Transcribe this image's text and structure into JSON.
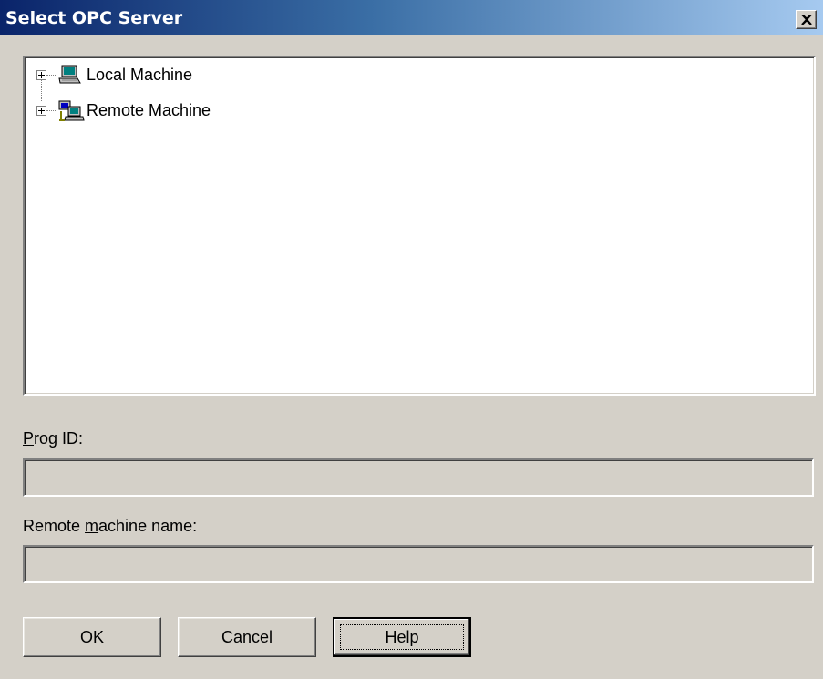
{
  "window": {
    "title": "Select OPC Server",
    "close_icon": "close-icon"
  },
  "tree": {
    "nodes": [
      {
        "label": "Local Machine",
        "icon": "computer-icon",
        "expander": "plus"
      },
      {
        "label": "Remote Machine",
        "icon": "network-computers-icon",
        "expander": "plus"
      }
    ]
  },
  "prog_id": {
    "label_accel": "P",
    "label_rest": "rog ID:",
    "value": ""
  },
  "remote_machine": {
    "label_pre": "Remote ",
    "label_accel": "m",
    "label_rest": "achine name:",
    "value": ""
  },
  "buttons": {
    "ok": "OK",
    "cancel": "Cancel",
    "help": "Help"
  }
}
